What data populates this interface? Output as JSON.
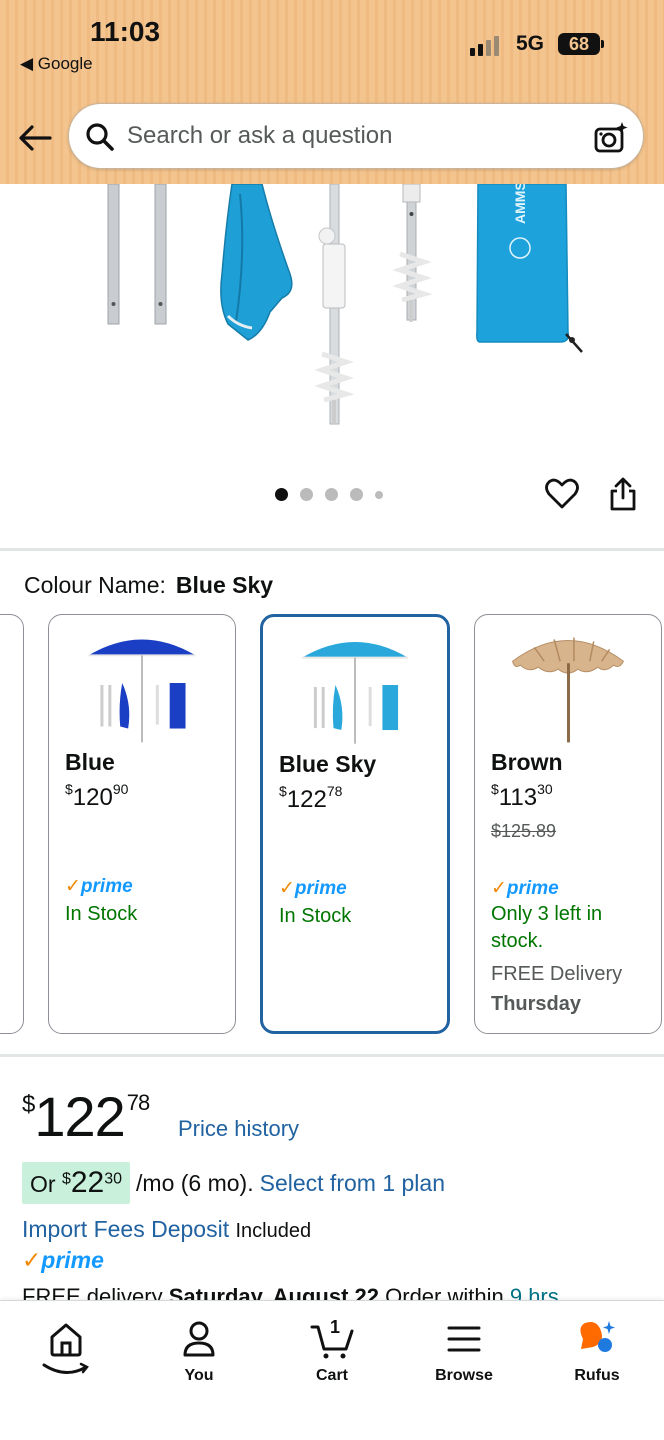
{
  "status_bar": {
    "time": "11:03",
    "back_label": "Google",
    "network": "5G",
    "battery": "68"
  },
  "search": {
    "placeholder": "Search or ask a question"
  },
  "carousel": {
    "dot_count": 5,
    "active_index": 0
  },
  "colour": {
    "label": "Colour Name:",
    "value": "Blue Sky"
  },
  "swatches": [
    {
      "name": "Blue",
      "price_whole": "120",
      "price_fraction": "90",
      "currency": "$",
      "prime": "prime",
      "stock": "In Stock"
    },
    {
      "name": "Blue Sky",
      "price_whole": "122",
      "price_fraction": "78",
      "currency": "$",
      "prime": "prime",
      "stock": "In Stock",
      "selected": true
    },
    {
      "name": "Brown",
      "price_whole": "113",
      "price_fraction": "30",
      "currency": "$",
      "old_price": "$125.89",
      "prime": "prime",
      "stock_line1": "Only 3 left in",
      "stock_line2": "stock.",
      "delivery_line1": "FREE Delivery",
      "delivery_line2": "Thursday"
    }
  ],
  "price": {
    "currency": "$",
    "whole": "122",
    "fraction": "78",
    "history_label": "Price history"
  },
  "installment": {
    "prefix": "Or",
    "currency": "$",
    "whole": "22",
    "fraction": "30",
    "suffix": "/mo (6 mo).",
    "link": "Select from 1 plan"
  },
  "import_fees": {
    "link": "Import Fees Deposit",
    "status": "Included"
  },
  "prime_label": "prime",
  "delivery": {
    "prefix": "FREE delivery",
    "date": "Saturday, August 22",
    "order": "Order within",
    "remaining": "9 hrs"
  },
  "nav": {
    "home": "",
    "you": "You",
    "cart": "Cart",
    "cart_count": "1",
    "browse": "Browse",
    "rufus": "Rufus"
  },
  "colors": {
    "header_bg": "#f4c48e",
    "link": "#2162a1",
    "prime": "#1399ff",
    "stock": "#007600",
    "selected_border": "#2162a1",
    "installment_bg": "#c8f0da"
  }
}
